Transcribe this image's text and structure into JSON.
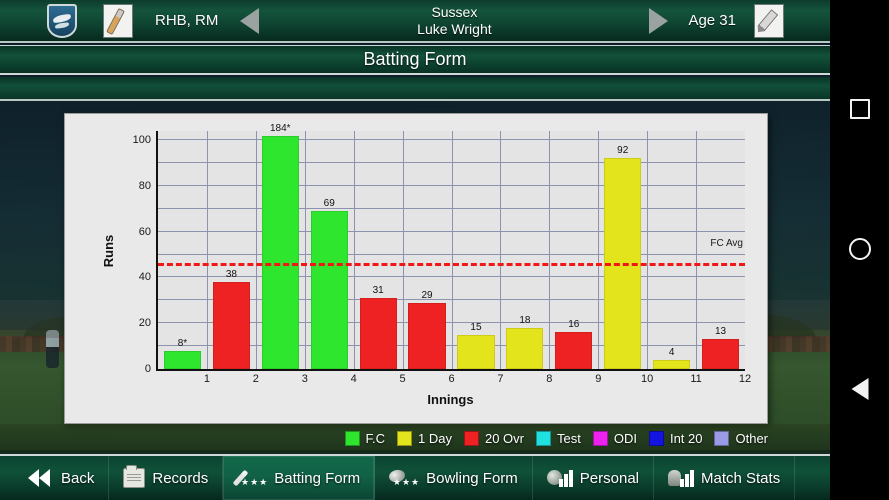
{
  "header": {
    "team_badge_icon": "shield-icon",
    "bat_icon": "cricket-bat-icon",
    "handedness": "RHB, RM",
    "prev_icon": "arrow-left-icon",
    "team": "Sussex",
    "player": "Luke Wright",
    "next_icon": "arrow-right-icon",
    "age": "Age 31",
    "edit_icon": "pencil-icon"
  },
  "title": "Batting Form",
  "chart_data": {
    "type": "bar",
    "title": "Batting Form",
    "xlabel": "Innings",
    "ylabel": "Runs",
    "ylim": [
      0,
      104
    ],
    "yticks": [
      0,
      20,
      40,
      60,
      80,
      100
    ],
    "minor_ytick_step": 10,
    "grid": true,
    "categories": [
      "1",
      "2",
      "3",
      "4",
      "5",
      "6",
      "7",
      "8",
      "9",
      "10",
      "11",
      "12"
    ],
    "values": [
      8,
      38,
      184,
      69,
      31,
      29,
      15,
      18,
      16,
      92,
      4,
      13
    ],
    "display_values": [
      "8*",
      "38",
      "184*",
      "69",
      "31",
      "29",
      "15",
      "18",
      "16",
      "92",
      "4",
      "13"
    ],
    "bar_formats": [
      "F.C",
      "20 Ovr",
      "F.C",
      "F.C",
      "20 Ovr",
      "20 Ovr",
      "1 Day",
      "1 Day",
      "20 Ovr",
      "1 Day",
      "1 Day",
      "20 Ovr"
    ],
    "bar_colors": [
      "#2ee62e",
      "#ee2222",
      "#2ee62e",
      "#2ee62e",
      "#ee2222",
      "#ee2222",
      "#e4e41c",
      "#e4e41c",
      "#ee2222",
      "#e4e41c",
      "#e4e41c",
      "#ee2222"
    ],
    "reference_line": {
      "label": "FC Avg",
      "value": 45,
      "color": "#f21616",
      "style": "dashed"
    },
    "note": "bars above the top of the axis are clipped at 100 (inns 3 = 184*)"
  },
  "legend": {
    "position": "bottom-right",
    "items": [
      {
        "label": "F.C",
        "color": "#2ee62e"
      },
      {
        "label": "1 Day",
        "color": "#e4e41c"
      },
      {
        "label": "20 Ovr",
        "color": "#ee2222"
      },
      {
        "label": "Test",
        "color": "#21e0e0"
      },
      {
        "label": "ODI",
        "color": "#ee22ee"
      },
      {
        "label": "Int 20",
        "color": "#1414e0"
      },
      {
        "label": "Other",
        "color": "#9a9ae6"
      }
    ]
  },
  "navbar": {
    "items": [
      {
        "label": "Back",
        "icon": "double-chevron-left-icon",
        "active": false
      },
      {
        "label": "Records",
        "icon": "records-book-icon",
        "active": false
      },
      {
        "label": "Batting Form",
        "icon": "bat-stars-icon",
        "active": true
      },
      {
        "label": "Bowling Form",
        "icon": "ball-stars-icon",
        "active": false
      },
      {
        "label": "Personal",
        "icon": "ball-barchart-icon",
        "active": false
      },
      {
        "label": "Match Stats",
        "icon": "glove-barchart-icon",
        "active": false
      }
    ]
  },
  "system_nav": {
    "recents": "square-icon",
    "home": "circle-icon",
    "back": "triangle-left-icon"
  }
}
